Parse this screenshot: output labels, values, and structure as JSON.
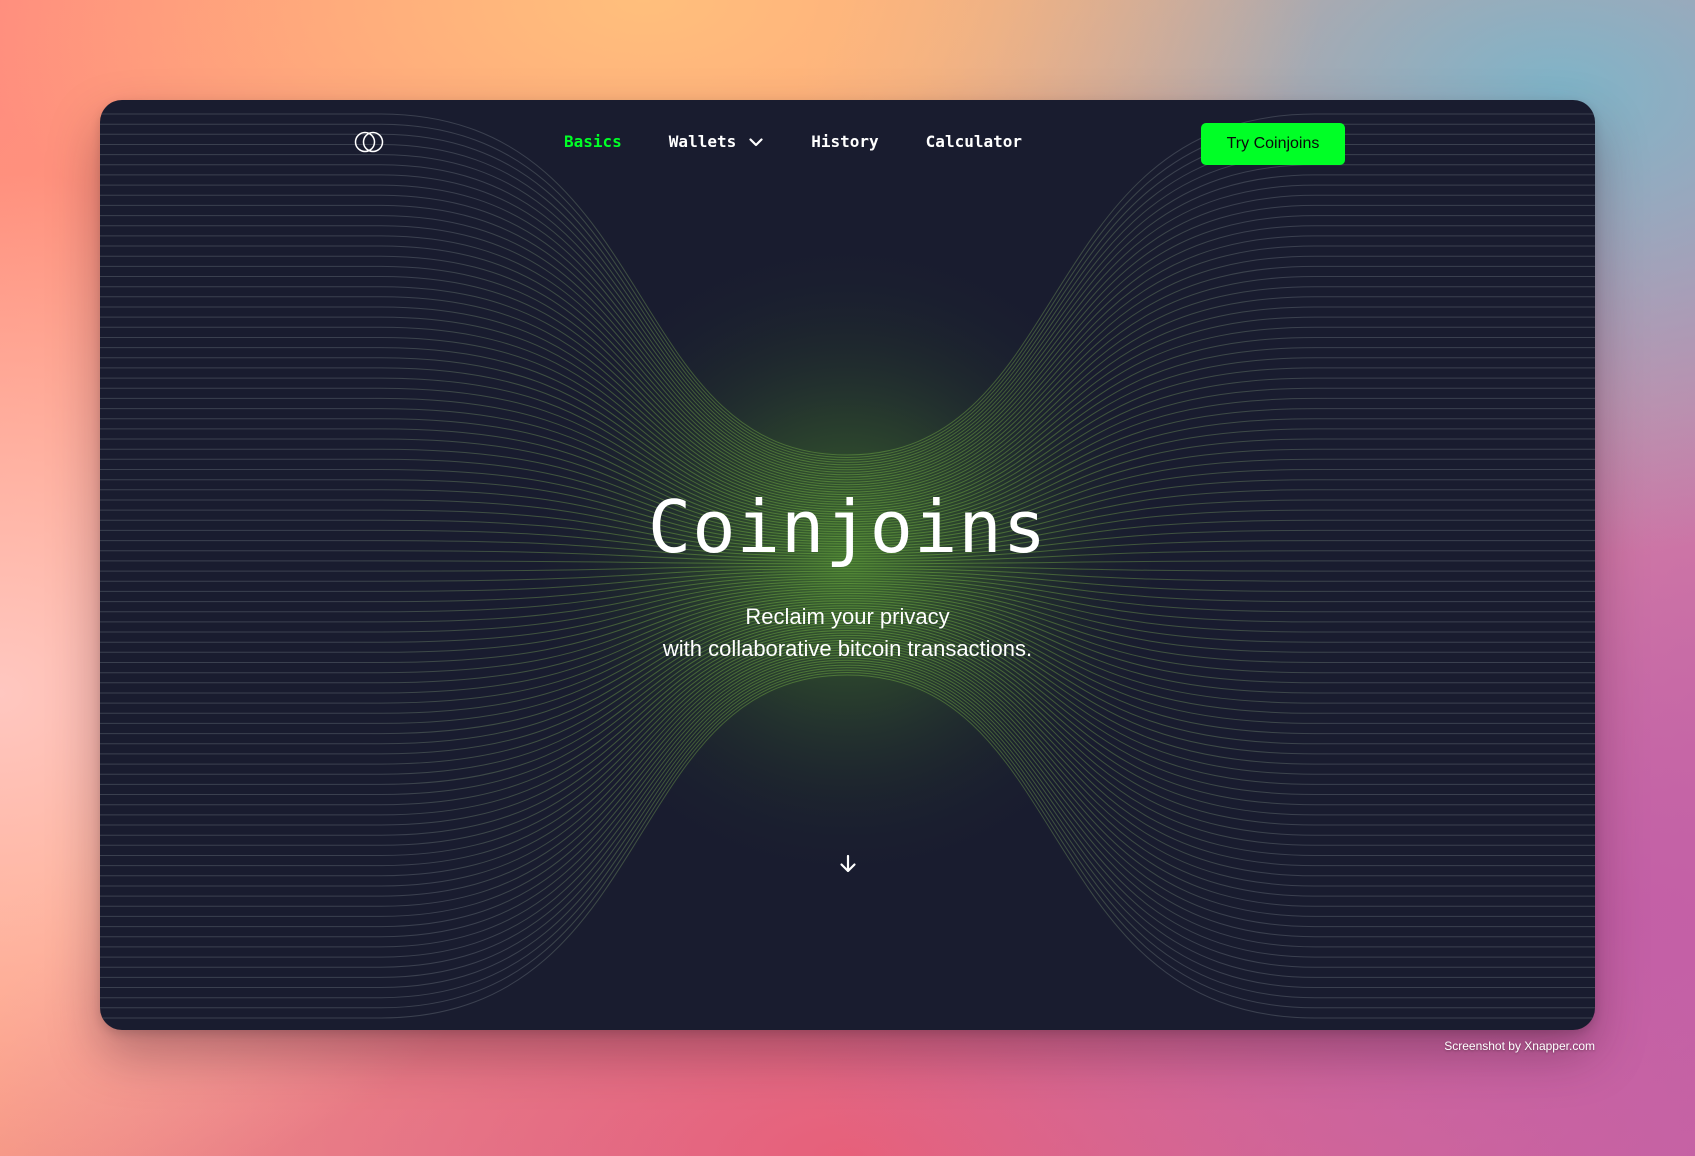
{
  "nav": {
    "logo_icon": "two-overlapping-circles-icon",
    "items": [
      {
        "label": "Basics",
        "active": true
      },
      {
        "label": "Wallets",
        "has_dropdown": true
      },
      {
        "label": "History"
      },
      {
        "label": "Calculator"
      }
    ],
    "cta_label": "Try Coinjoins"
  },
  "hero": {
    "title": "Coinjoins",
    "subtitle_line1": "Reclaim your privacy",
    "subtitle_line2": "with collaborative bitcoin transactions.",
    "scroll_icon": "arrow-down-icon"
  },
  "footer": {
    "credit": "Screenshot by Xnapper.com"
  },
  "colors": {
    "accent": "#00ff26",
    "window_bg": "#191c2f",
    "text": "#ffffff",
    "line_color": "#4a5060",
    "glow": "#4c8a2e"
  }
}
